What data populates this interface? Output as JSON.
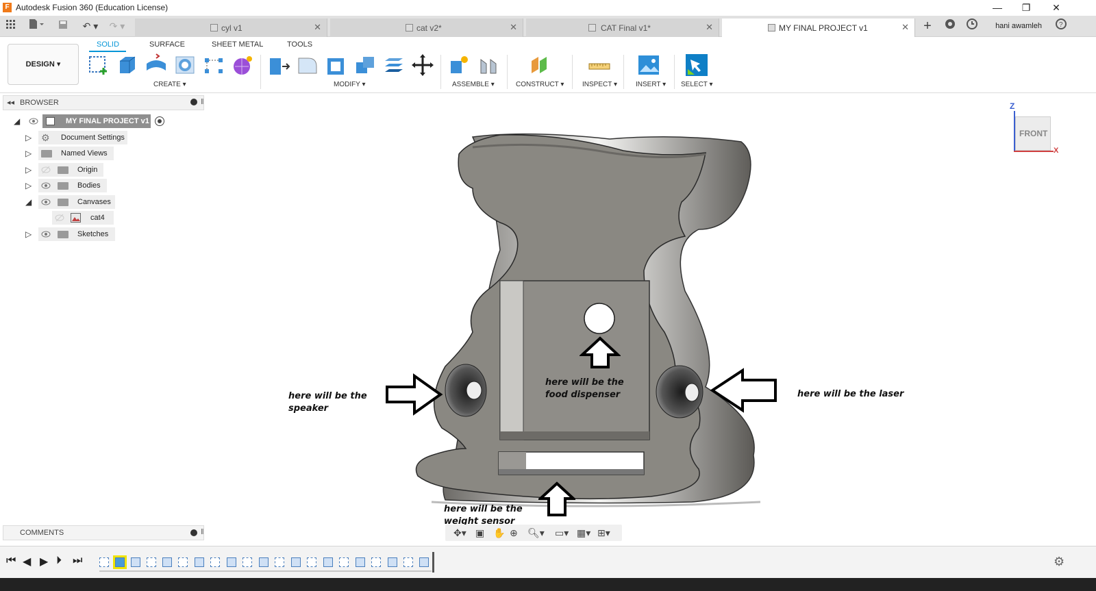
{
  "app": {
    "window_title": "Autodesk Fusion 360 (Education License)",
    "logo_letter": "F",
    "user_name": "hani awamleh"
  },
  "tabs": [
    {
      "label": "cyl v1"
    },
    {
      "label": "cat v2*"
    },
    {
      "label": "CAT Final v1*"
    },
    {
      "label": "MY FINAL PROJECT v1"
    }
  ],
  "toolbar": {
    "workspace": "DESIGN",
    "workspace_tabs": [
      "SOLID",
      "SURFACE",
      "SHEET METAL",
      "TOOLS"
    ],
    "active_workspace_tab": "SOLID",
    "groups": [
      "CREATE",
      "MODIFY",
      "ASSEMBLE",
      "CONSTRUCT",
      "INSPECT",
      "INSERT",
      "SELECT"
    ]
  },
  "browser": {
    "title": "BROWSER",
    "root": "MY FINAL PROJECT v1",
    "items": [
      {
        "label": "Document Settings",
        "icon": "gear-icon"
      },
      {
        "label": "Named Views",
        "icon": "folder-icon"
      },
      {
        "label": "Origin",
        "icon": "folder-icon"
      },
      {
        "label": "Bodies",
        "icon": "folder-icon"
      },
      {
        "label": "Canvases",
        "icon": "folder-icon",
        "expanded": true
      },
      {
        "label": "cat4",
        "icon": "canvas-image-icon"
      },
      {
        "label": "Sketches",
        "icon": "folder-icon"
      }
    ]
  },
  "viewcube": {
    "face": "FRONT",
    "axis_z": "Z",
    "axis_x": "X"
  },
  "annotations": {
    "speaker": "here will be the speaker",
    "food": "here will be the food dispenser",
    "laser": "here will be the laser",
    "weight": "here will be the weight sensor"
  },
  "comments": {
    "title": "COMMENTS"
  },
  "colors": {
    "accent": "#0696d7",
    "model": "#8a8882",
    "timeline_highlight": "#f0e400"
  }
}
